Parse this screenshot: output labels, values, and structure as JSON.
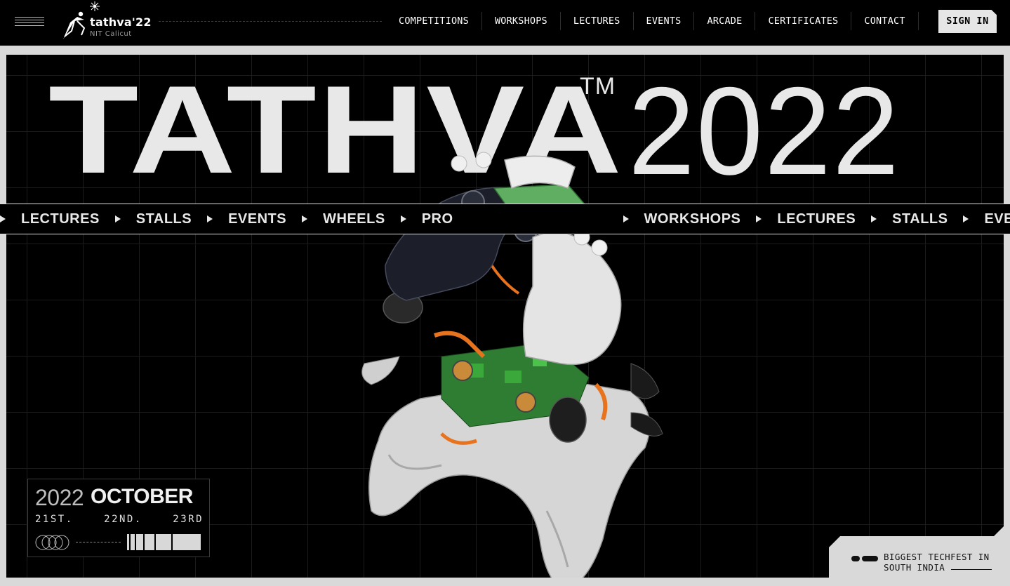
{
  "nav": {
    "logo_text": "tathva'22",
    "logo_sub": "NIT Calicut",
    "menu": [
      "COMPETITIONS",
      "WORKSHOPS",
      "LECTURES",
      "EVENTS",
      "ARCADE",
      "CERTIFICATES",
      "CONTACT"
    ],
    "signin_label": "SIGN IN"
  },
  "hero": {
    "title": "TATHVA",
    "tm": "TM",
    "year": "2022",
    "marquee": [
      "LECTURES",
      "STALLS",
      "EVENTS",
      "WHEELS",
      "PRO",
      "WORKSHOPS",
      "LECTURES",
      "STALLS",
      "EVEN"
    ],
    "date": {
      "year": "2022",
      "month": "OCTOBER",
      "days": [
        "21ST.",
        "22ND.",
        "23RD"
      ]
    },
    "tagline": [
      "BIGGEST TECHFEST IN",
      "SOUTH INDIA"
    ]
  },
  "colors": {
    "background": "#000000",
    "frame": "#d9d9d9",
    "text_light": "#e8e8e8",
    "accent_orange": "#e8731f",
    "accent_green": "#3aa83a"
  },
  "icons": [
    "hamburger-icon",
    "tathva-logo",
    "play-arrow-icon",
    "rings-icon",
    "barcode-icon",
    "pill-icon"
  ]
}
